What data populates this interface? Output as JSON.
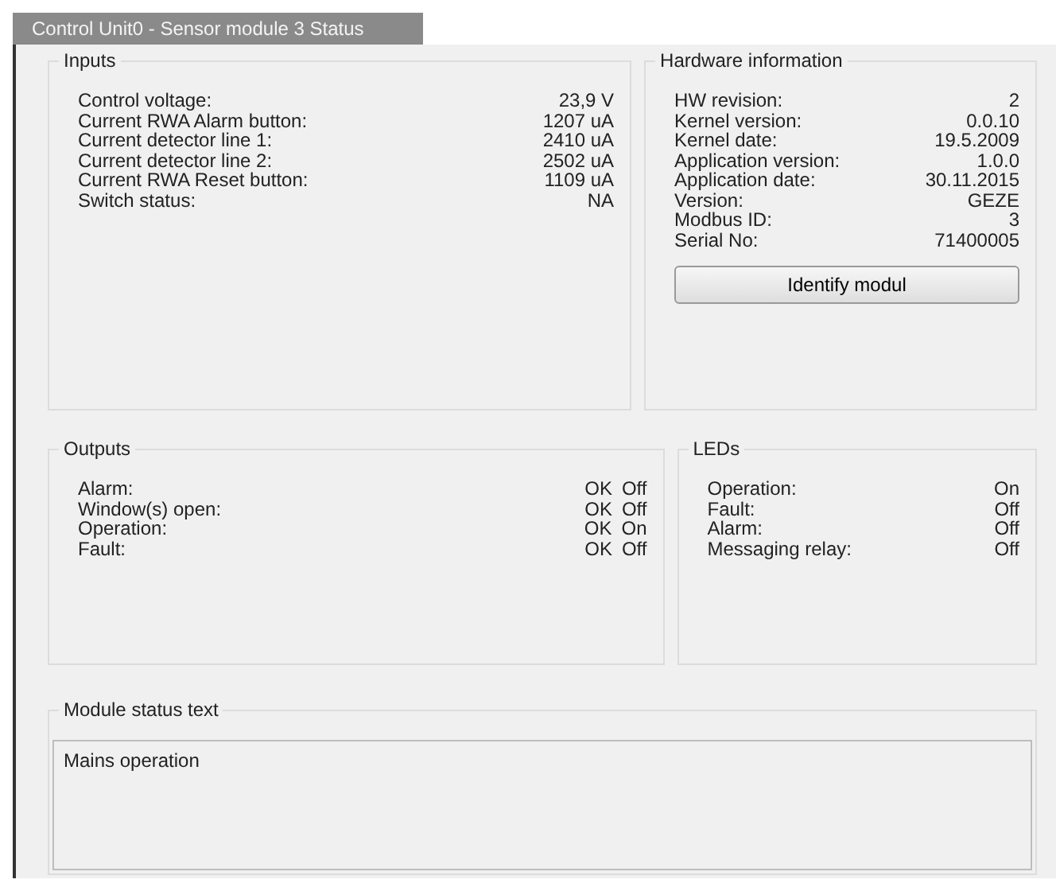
{
  "tab": {
    "title": "Control Unit0 - Sensor module 3 Status",
    "selected": true
  },
  "inputs": {
    "title": "Inputs",
    "rows": [
      {
        "label": "Control voltage:",
        "value": "23,9 V"
      },
      {
        "label": "Current RWA Alarm button:",
        "value": "1207 uA"
      },
      {
        "label": "Current detector line 1:",
        "value": "2410 uA"
      },
      {
        "label": "Current detector line 2:",
        "value": "2502 uA"
      },
      {
        "label": "Current RWA Reset button:",
        "value": "1109 uA"
      },
      {
        "label": "Switch status:",
        "value": "NA"
      }
    ]
  },
  "hardware_information": {
    "title": "Hardware information",
    "rows": [
      {
        "label": "HW revision:",
        "value": "2"
      },
      {
        "label": "Kernel version:",
        "value": "0.0.10"
      },
      {
        "label": "Kernel date:",
        "value": "19.5.2009"
      },
      {
        "label": "Application version:",
        "value": "1.0.0"
      },
      {
        "label": "Application date:",
        "value": "30.11.2015"
      },
      {
        "label": "Version:",
        "value": "GEZE"
      },
      {
        "label": "Modbus ID:",
        "value": "3"
      },
      {
        "label": "Serial No:",
        "value": "71400005"
      }
    ],
    "button": "Identify modul"
  },
  "outputs": {
    "title": "Outputs",
    "rows": [
      {
        "label": "Alarm:",
        "status": "OK",
        "value": "Off"
      },
      {
        "label": "Window(s) open:",
        "status": "OK",
        "value": "Off"
      },
      {
        "label": "Operation:",
        "status": "OK",
        "value": "On"
      },
      {
        "label": "Fault:",
        "status": "OK",
        "value": "Off"
      }
    ]
  },
  "leds": {
    "title": "LEDs",
    "rows": [
      {
        "label": "Operation:",
        "value": "On"
      },
      {
        "label": "Fault:",
        "value": "Off"
      },
      {
        "label": "Alarm:",
        "value": "Off"
      },
      {
        "label": "Messaging relay:",
        "value": "Off"
      }
    ]
  },
  "module_status_text": {
    "title": "Module status text",
    "value": "Mains operation"
  }
}
